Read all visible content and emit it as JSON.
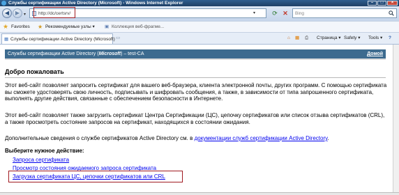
{
  "window": {
    "title": "Службы сертификации Active Directory (Microsoft) - Windows Internet Explorer"
  },
  "address": {
    "url": "http://dc/certsrv/"
  },
  "search": {
    "placeholder": "Bing"
  },
  "favorites_bar": {
    "favorites_label": "Favorites",
    "items": [
      "Рекомендуемые узлы ▾",
      "Коллекция веб-фрагме..."
    ]
  },
  "tab": {
    "label": "Службы сертификации Active Directory (Microsoft)"
  },
  "command_bar": {
    "page": "Страница ▾",
    "safety": "Safety ▾",
    "tools": "Tools ▾",
    "help": "?"
  },
  "header": {
    "title_prefix": "Службы сертификации Active Directory (",
    "title_brand": "Microsoft",
    "title_suffix": ")  –  test-CA",
    "home_link": "Домой"
  },
  "welcome": {
    "heading": "Добро пожаловать",
    "p1": "Этот веб-сайт позволяет запросить сертификат для вашего веб-браузера, клиента электронной почты, других программ. С помощью сертификата вы сможете удостоверять свою личность, подписывать и шифровать сообщения, а также, в зависимости от типа запрошенного сертификата, выполнять другие действия, связанные с обеспечением безопасности в Интернете.",
    "p2": "Этот веб-сайт позволяет также загрузить сертификат Центра Сертификации (ЦС), цепочку сертификатов или список отзыва сертификатов (CRL), а также просмотреть состояние запросов на сертификат, находящихся в состоянии ожидания.",
    "p3_prefix": "Дополнительные сведения о службе сертификатов Active Directory см. в ",
    "p3_link": "документации служб сертификации Active Directory",
    "p3_suffix": "."
  },
  "actions": {
    "heading": "Выберите нужное действие:",
    "items": [
      "Запроса сертификата",
      "Просмотр состояния ожидаемого запроса сертификата",
      "Загрузка сертификата ЦС, цепочки сертификатов или CRL"
    ]
  }
}
